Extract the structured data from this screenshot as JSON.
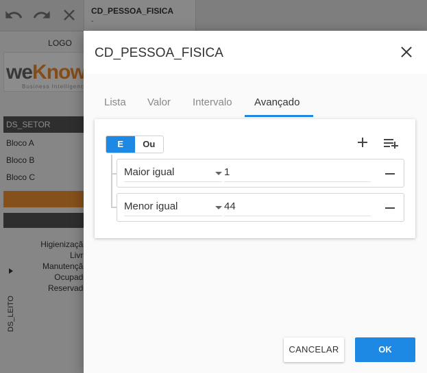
{
  "toolbar": {
    "undo_icon": "undo-icon",
    "redo_icon": "redo-icon",
    "close_icon": "close-icon"
  },
  "document_tab": {
    "title": "CD_PESSOA_FISICA",
    "subtitle": "-"
  },
  "sidebar": {
    "logo_label": "LOGO",
    "logo_text_gray": "we",
    "logo_text_orange": "Know",
    "logo_tagline": "Business Intelligence",
    "setor_header": "DS_SETOR",
    "setor_items": [
      "Bloco A",
      "Bloco B",
      "Bloco C"
    ],
    "leito_items": [
      "Higienização",
      "Livre",
      "Manutenção",
      "Ocupado",
      "Reservado"
    ],
    "leito_label": "DS_LEITO"
  },
  "dialog": {
    "title": "CD_PESSOA_FISICA",
    "tabs": [
      "Lista",
      "Valor",
      "Intervalo",
      "Avançado"
    ],
    "active_tab": "Avançado",
    "logic_toggle": {
      "options": [
        "E",
        "Ou"
      ],
      "selected": "E"
    },
    "rules": [
      {
        "operator": "Maior igual",
        "value": "1"
      },
      {
        "operator": "Menor igual",
        "value": "44"
      }
    ],
    "cancel_label": "CANCELAR",
    "ok_label": "OK"
  },
  "colors": {
    "accent": "#1e88e5",
    "brand_orange": "#f39233",
    "header_dark": "#555555"
  }
}
